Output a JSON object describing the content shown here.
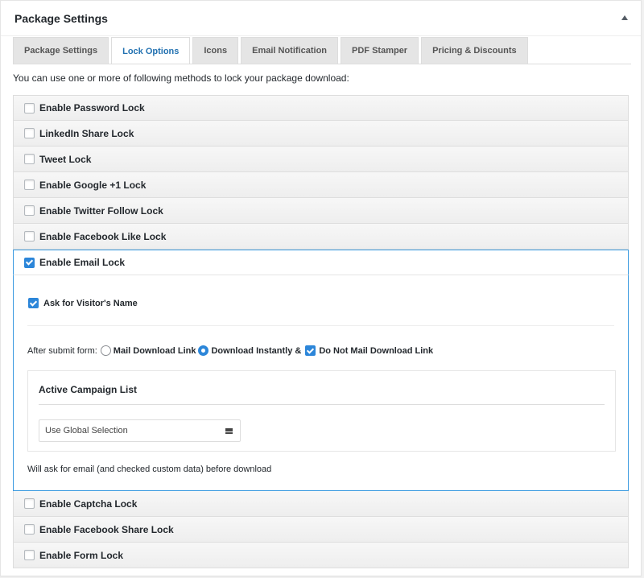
{
  "header": {
    "title": "Package Settings",
    "toggle_icon": "caret-up-icon"
  },
  "tabs": [
    {
      "label": "Package Settings",
      "active": false
    },
    {
      "label": "Lock Options",
      "active": true
    },
    {
      "label": "Icons",
      "active": false
    },
    {
      "label": "Email Notification",
      "active": false
    },
    {
      "label": "PDF Stamper",
      "active": false
    },
    {
      "label": "Pricing & Discounts",
      "active": false
    }
  ],
  "intro": "You can use one or more of following methods to lock your package download:",
  "locks": [
    {
      "label": "Enable Password Lock",
      "checked": false
    },
    {
      "label": "LinkedIn Share Lock",
      "checked": false
    },
    {
      "label": "Tweet Lock",
      "checked": false
    },
    {
      "label": "Enable Google +1 Lock",
      "checked": false
    },
    {
      "label": "Enable Twitter Follow Lock",
      "checked": false
    },
    {
      "label": "Enable Facebook Like Lock",
      "checked": false
    },
    {
      "label": "Enable Email Lock",
      "checked": true
    },
    {
      "label": "Enable Captcha Lock",
      "checked": false
    },
    {
      "label": "Enable Facebook Share Lock",
      "checked": false
    },
    {
      "label": "Enable Form Lock",
      "checked": false
    }
  ],
  "email_lock": {
    "ask_name_label": "Ask for Visitor's Name",
    "ask_name_checked": true,
    "after_submit_label": "After submit form:",
    "options": [
      {
        "label": "Mail Download Link",
        "selected": false
      },
      {
        "label": "Download Instantly &",
        "selected": true
      }
    ],
    "do_not_mail_label": "Do Not Mail Download Link",
    "do_not_mail_checked": true,
    "campaign": {
      "title": "Active Campaign List",
      "selected": "Use Global Selection",
      "select_icon": "menu-icon"
    },
    "footnote": "Will ask for email (and checked custom data) before download"
  },
  "colors": {
    "accent": "#2271b1",
    "checkbox_checked": "#2c86d9",
    "active_border": "#3a9ae0"
  }
}
